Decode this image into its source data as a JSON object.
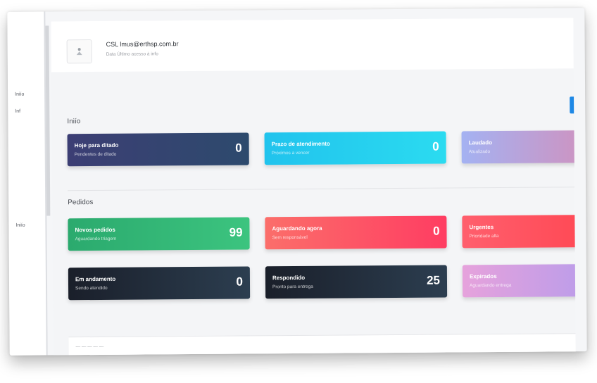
{
  "sidebar": {
    "items": [
      {
        "label": "Iniío"
      },
      {
        "label": "Inf"
      },
      {
        "label": "Iniío"
      }
    ]
  },
  "header": {
    "user_name": "CSL  lmus@erthsp.com.br",
    "user_sub": "Data Último acesso à info",
    "logo_icon": "app-logo-icon"
  },
  "sections": [
    {
      "title": "Iniío",
      "cards": [
        {
          "title": "Hoje para ditado",
          "subtitle": "Pendentes de ditado",
          "value": "0",
          "gradient": [
            "#3c3e74",
            "#2d4a6d"
          ]
        },
        {
          "title": "Prazo de atendimento",
          "subtitle": "Próximos a vencer",
          "value": "0",
          "gradient": [
            "#21c3ed",
            "#2bdbf0"
          ]
        },
        {
          "title": "Laudado",
          "subtitle": "Atualizado",
          "value": "",
          "gradient": [
            "#a4b2f2",
            "#e284a9"
          ]
        }
      ]
    },
    {
      "title": "Pedidos",
      "cards": [
        {
          "title": "Novos pedidos",
          "subtitle": "Aguardando triagem",
          "value": "99",
          "gradient": [
            "#2baa6e",
            "#3cc47f"
          ]
        },
        {
          "title": "Aguardando agora",
          "subtitle": "Sem responsável",
          "value": "0",
          "gradient": [
            "#fb6e6a",
            "#ff3d62"
          ]
        },
        {
          "title": "Urgentes",
          "subtitle": "Prioridade alta",
          "value": "",
          "gradient": [
            "#ff5f6d",
            "#ff3e49"
          ]
        },
        {
          "title": "Em andamento",
          "subtitle": "Sendo atendido",
          "value": "0",
          "gradient": [
            "#1a1f2a",
            "#2c3e50"
          ]
        },
        {
          "title": "Respondido",
          "subtitle": "Pronto para entrega",
          "value": "25",
          "gradient": [
            "#1a1f2a",
            "#2c3e50"
          ]
        },
        {
          "title": "Expirados",
          "subtitle": "Aguardando entrega",
          "value": "",
          "gradient": [
            "#e6a2dc",
            "#a79af0"
          ]
        }
      ]
    }
  ],
  "bottom": {
    "label": "— — — — —"
  },
  "colors": {
    "accent": "#1e88e5",
    "frame_bg": "#f5f6f8"
  }
}
